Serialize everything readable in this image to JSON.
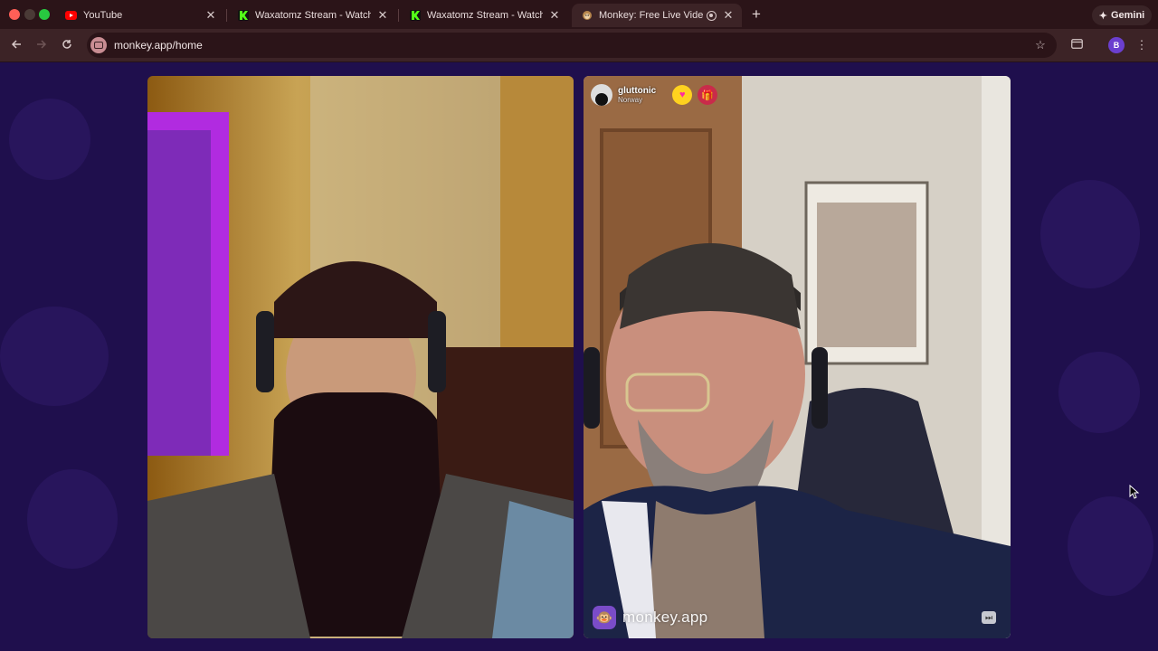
{
  "browser": {
    "tabs": [
      {
        "title": "YouTube",
        "favicon": "youtube-icon",
        "active": false
      },
      {
        "title": "Waxatomz Stream - Watch Live",
        "favicon": "kick-icon",
        "active": false
      },
      {
        "title": "Waxatomz Stream - Watch Live",
        "favicon": "kick-icon",
        "active": false
      },
      {
        "title": "Monkey: Free Live Video Chat",
        "favicon": "monkey-icon",
        "active": true
      }
    ],
    "gemini_label": "Gemini",
    "url": "monkey.app/home",
    "profile_initial": "B",
    "colors": {
      "tabstrip": "#2b1418",
      "toolbar": "#3c2326",
      "page_bg": "#1f0f4d"
    }
  },
  "call": {
    "remote_user": {
      "name": "gluttonic",
      "country": "Norway"
    },
    "brand_watermark": "monkey.app",
    "icons": [
      "heart-badge-icon",
      "gift-badge-icon",
      "skip-icon",
      "monkey-logo-icon"
    ]
  }
}
